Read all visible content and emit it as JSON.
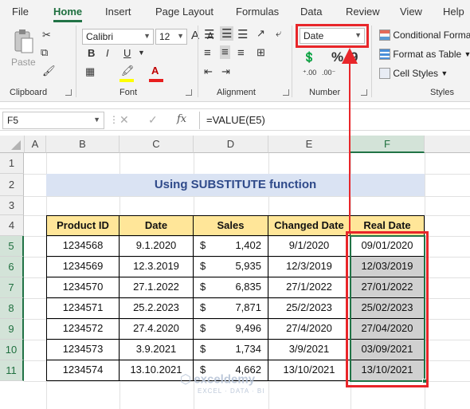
{
  "menu": {
    "items": [
      "File",
      "Home",
      "Insert",
      "Page Layout",
      "Formulas",
      "Data",
      "Review",
      "View",
      "Help"
    ],
    "active": "Home"
  },
  "ribbon": {
    "clipboard": {
      "label": "Clipboard",
      "paste_label": "Paste"
    },
    "font": {
      "label": "Font",
      "font_name": "Calibri",
      "font_size": "12",
      "bold": "B",
      "italic": "I",
      "underline": "U",
      "grow": "A",
      "shrink": "A"
    },
    "alignment": {
      "label": "Alignment"
    },
    "number": {
      "label": "Number",
      "format_value": "Date",
      "percent": "%",
      "comma": "9"
    },
    "styles": {
      "label": "Styles",
      "conditional": "Conditional Forma",
      "format_table": "Format as Table",
      "cell_styles": "Cell Styles"
    }
  },
  "formula_bar": {
    "name_box": "F5",
    "cancel": "✕",
    "enter": "✓",
    "fx": "fx",
    "formula": "=VALUE(E5)"
  },
  "colors": {
    "accent": "#217346",
    "header_fill": "#ffe699",
    "title_fill": "#dae3f3",
    "highlight": "#e8262a",
    "real_fill": "#d0d0d0"
  },
  "sheet": {
    "columns": [
      "A",
      "B",
      "C",
      "D",
      "E",
      "F"
    ],
    "rows": [
      "1",
      "2",
      "3",
      "4",
      "5",
      "6",
      "7",
      "8",
      "9",
      "10",
      "11"
    ],
    "title": "Using SUBSTITUTE function",
    "headers": [
      "Product ID",
      "Date",
      "Sales",
      "Changed Date",
      "Real Date"
    ],
    "data": [
      {
        "id": "1234568",
        "date": "9.1.2020",
        "cur": "$",
        "sales": "1,402",
        "changed": "9/1/2020",
        "real": "09/01/2020"
      },
      {
        "id": "1234569",
        "date": "12.3.2019",
        "cur": "$",
        "sales": "5,935",
        "changed": "12/3/2019",
        "real": "12/03/2019"
      },
      {
        "id": "1234570",
        "date": "27.1.2022",
        "cur": "$",
        "sales": "6,835",
        "changed": "27/1/2022",
        "real": "27/01/2022"
      },
      {
        "id": "1234571",
        "date": "25.2.2023",
        "cur": "$",
        "sales": "7,871",
        "changed": "25/2/2023",
        "real": "25/02/2023"
      },
      {
        "id": "1234572",
        "date": "27.4.2020",
        "cur": "$",
        "sales": "9,496",
        "changed": "27/4/2020",
        "real": "27/04/2020"
      },
      {
        "id": "1234573",
        "date": "3.9.2021",
        "cur": "$",
        "sales": "1,734",
        "changed": "3/9/2021",
        "real": "03/09/2021"
      },
      {
        "id": "1234574",
        "date": "13.10.2021",
        "cur": "$",
        "sales": "4,662",
        "changed": "13/10/2021",
        "real": "13/10/2021"
      }
    ]
  },
  "watermark": {
    "brand": "exceldemy",
    "tagline": "EXCEL · DATA · BI"
  }
}
